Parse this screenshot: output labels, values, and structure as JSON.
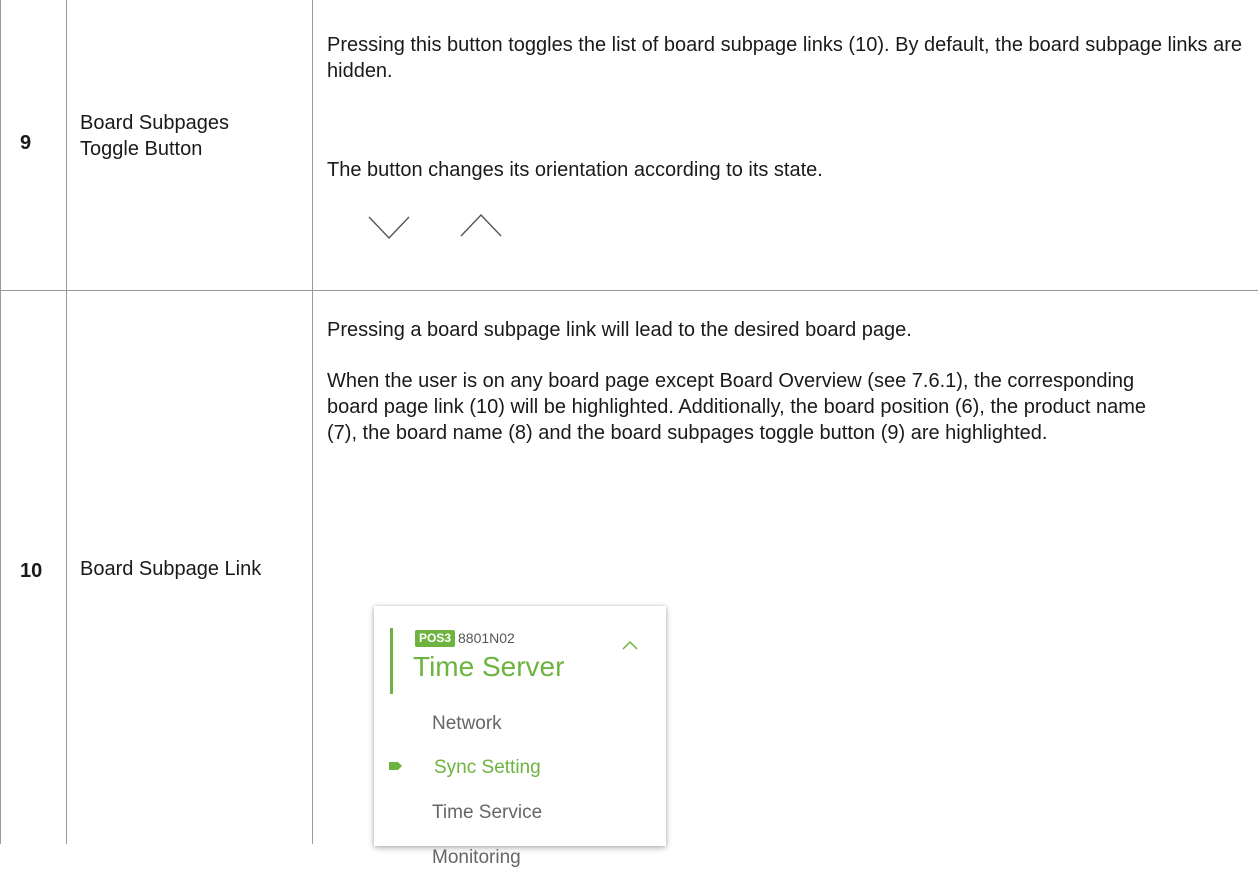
{
  "rows": [
    {
      "number": "9",
      "label_line1": "Board Subpages",
      "label_line2": "Toggle Button",
      "desc_paragraph1": "Pressing this button toggles the list of board subpage links (10). By default, the board subpage links are hidden.",
      "desc_paragraph2": "The button changes its orientation according to its state.",
      "icons": [
        "chevron-down-icon",
        "chevron-up-icon"
      ]
    },
    {
      "number": "10",
      "label": "Board Subpage Link",
      "desc_paragraph1": "Pressing a board subpage link will lead to the desired board page.",
      "desc_paragraph2": "When the user is on any board page except Board Overview (see 7.6.1), the corresponding board page link (10) will be highlighted. Additionally, the board position (6), the product name (7), the board name (8) and the board subpages toggle button (9) are highlighted."
    }
  ],
  "sidebar_mock": {
    "position_badge": "POS3",
    "product_name": "8801N02",
    "board_name": "Time Server",
    "links": [
      {
        "label": "Network",
        "active": false
      },
      {
        "label": "Sync Setting",
        "active": true
      },
      {
        "label": "Time Service",
        "active": false
      },
      {
        "label": "Monitoring",
        "active": false
      }
    ],
    "accent_color": "#6db33f",
    "link_color": "#666666"
  }
}
